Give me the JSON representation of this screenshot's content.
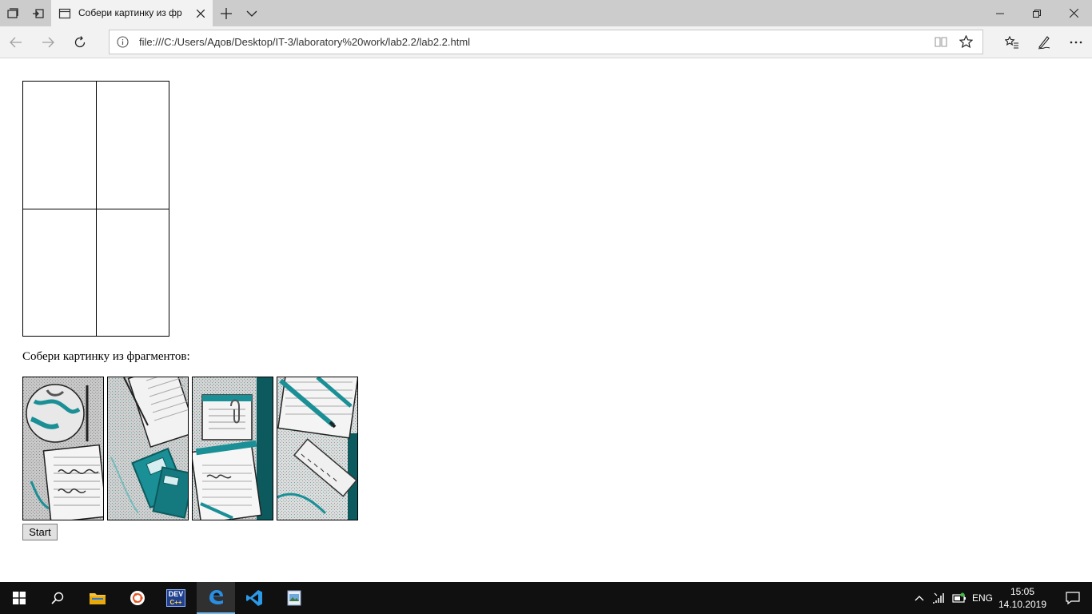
{
  "browser": {
    "tab_title": "Собери картинку из фр",
    "address": "file:///C:/Users/Адов/Desktop/IT-3/laboratory%20work/lab2.2/lab2.2.html"
  },
  "page": {
    "prompt": "Собери картинку из фрагментов:",
    "start_label": "Start",
    "fragments": [
      {
        "name": "fragment-globe"
      },
      {
        "name": "fragment-books"
      },
      {
        "name": "fragment-notepad"
      },
      {
        "name": "fragment-pencils-ruler"
      }
    ]
  },
  "taskbar": {
    "language": "ENG",
    "time": "15:05",
    "date": "14.10.2019",
    "devcpp_label": "DEV"
  },
  "colors": {
    "teal": "#1a8f96",
    "dark_teal": "#0d5a5e",
    "tabbar": "#cccccc",
    "taskbar": "#101010",
    "accent": "#76b9ed"
  }
}
